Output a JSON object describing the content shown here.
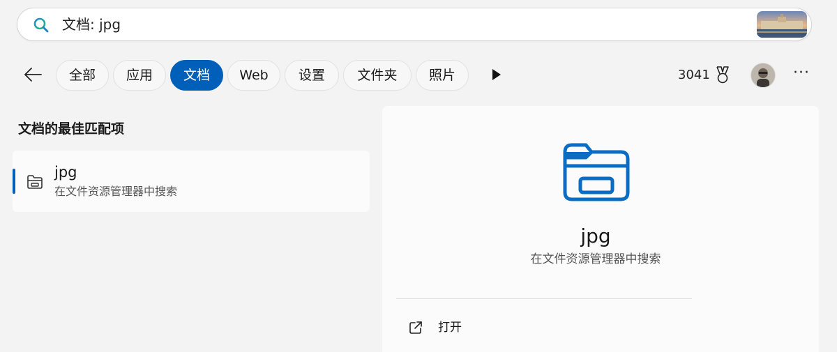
{
  "search": {
    "query": "文档: jpg",
    "icon": "search-icon"
  },
  "tabs": [
    {
      "label": "全部",
      "active": false
    },
    {
      "label": "应用",
      "active": false
    },
    {
      "label": "文档",
      "active": true
    },
    {
      "label": "Web",
      "active": false
    },
    {
      "label": "设置",
      "active": false
    },
    {
      "label": "文件夹",
      "active": false
    },
    {
      "label": "照片",
      "active": false
    }
  ],
  "toolbar": {
    "points": "3041",
    "accent_color": "#005fb8"
  },
  "best_match": {
    "section_title": "文档的最佳匹配项",
    "items": [
      {
        "title": "jpg",
        "subtitle": "在文件资源管理器中搜索",
        "icon": "folder-icon"
      }
    ]
  },
  "preview": {
    "title": "jpg",
    "subtitle": "在文件资源管理器中搜索",
    "icon": "folder-icon",
    "actions": [
      {
        "label": "打开",
        "icon": "open-external-icon"
      }
    ]
  }
}
